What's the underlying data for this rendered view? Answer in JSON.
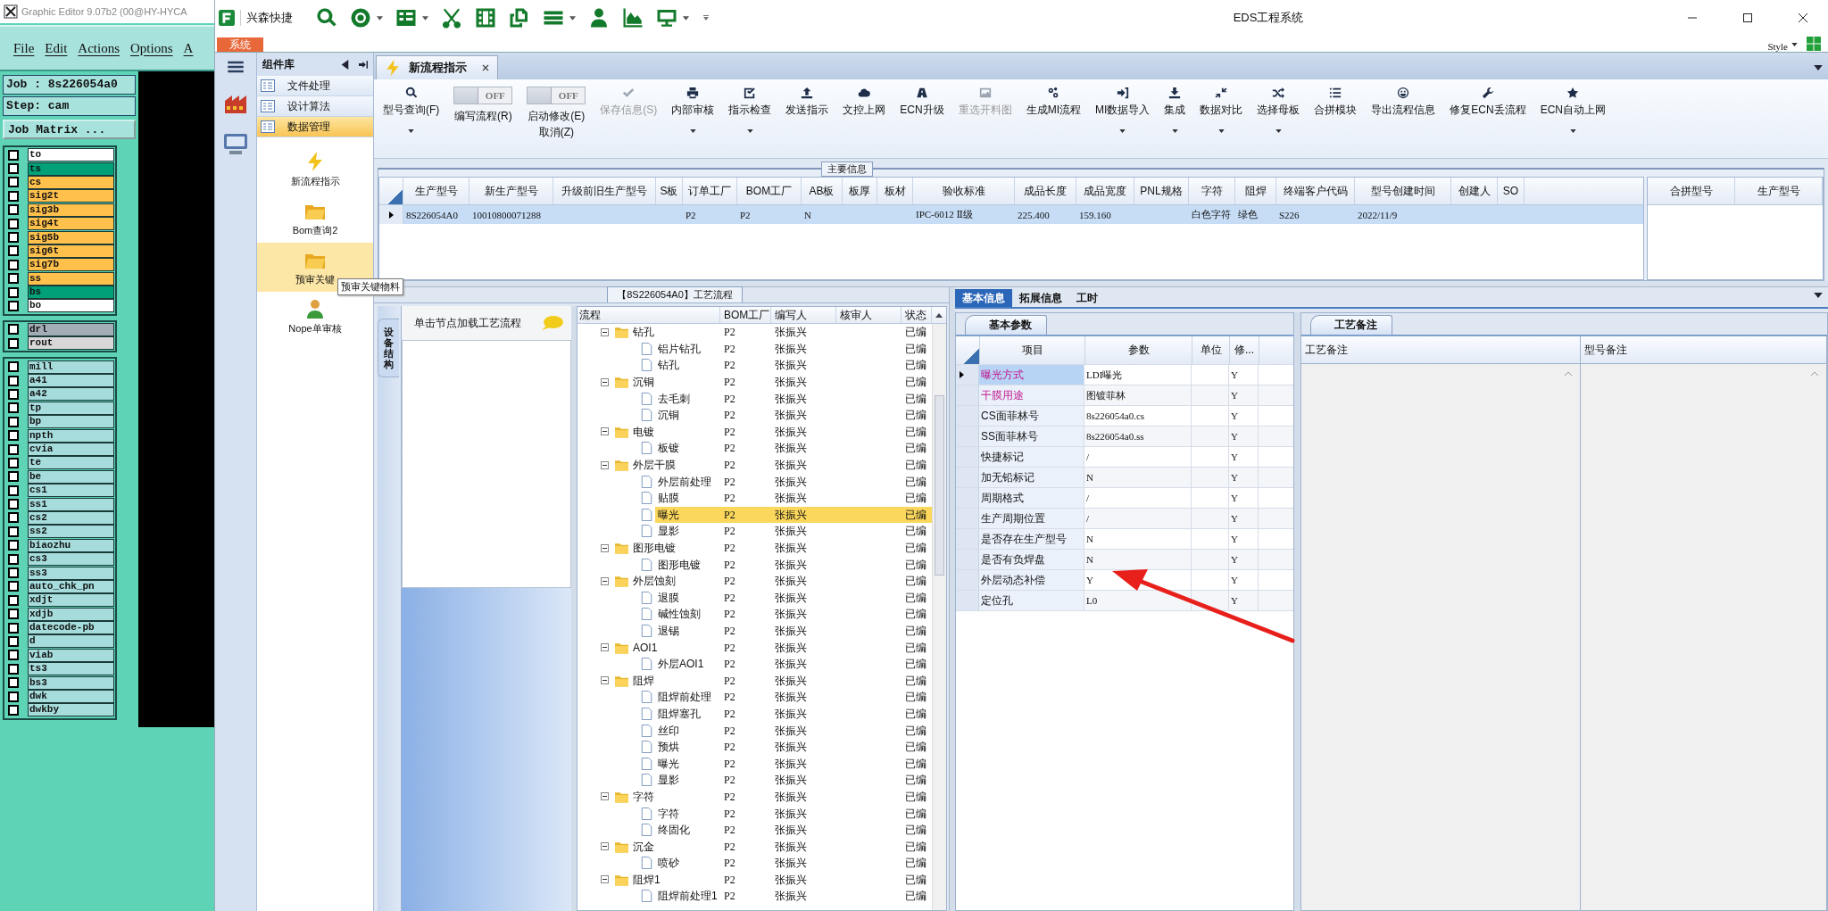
{
  "graphic_editor": {
    "title": "Graphic Editor 9.07b2 (00@HY-HYCA",
    "menu": [
      "File",
      "Edit",
      "Actions",
      "Options",
      "A"
    ],
    "job": "Job : 8s226054a0",
    "step": "Step: cam",
    "matrix_button": "Job Matrix ...",
    "layer_groups": [
      {
        "layers": [
          {
            "name": "to",
            "checked": false,
            "color": "#ffffff"
          },
          {
            "name": "ts",
            "checked": false,
            "color": "#00a078"
          },
          {
            "name": "cs",
            "checked": false,
            "color": "#ffc04c"
          },
          {
            "name": "sig2t",
            "checked": false,
            "color": "#ffc04c"
          },
          {
            "name": "sig3b",
            "checked": false,
            "color": "#ffc04c"
          },
          {
            "name": "sig4t",
            "checked": false,
            "color": "#ffc04c"
          },
          {
            "name": "sig5b",
            "checked": false,
            "color": "#ffc04c"
          },
          {
            "name": "sig6t",
            "checked": false,
            "color": "#ffc04c"
          },
          {
            "name": "sig7b",
            "checked": false,
            "color": "#ffc04c"
          },
          {
            "name": "ss",
            "checked": false,
            "color": "#ffc04c"
          },
          {
            "name": "bs",
            "checked": false,
            "color": "#00a078"
          },
          {
            "name": "bo",
            "checked": false,
            "color": "#ffffff"
          }
        ]
      },
      {
        "layers": [
          {
            "name": "drl",
            "checked": false,
            "color": "#a3adb5"
          },
          {
            "name": "rout",
            "checked": false,
            "color": "#d8d8d8"
          }
        ]
      },
      {
        "layers": [
          {
            "name": "mill",
            "checked": false,
            "color": "#a6dcdc"
          },
          {
            "name": "a41",
            "checked": false,
            "color": "#a6dcdc"
          },
          {
            "name": "a42",
            "checked": false,
            "color": "#a6dcdc"
          },
          {
            "name": "tp",
            "checked": false,
            "color": "#a6dcdc"
          },
          {
            "name": "bp",
            "checked": false,
            "color": "#a6dcdc"
          },
          {
            "name": "npth",
            "checked": false,
            "color": "#a6dcdc"
          },
          {
            "name": "cvia",
            "checked": false,
            "color": "#a6dcdc"
          },
          {
            "name": "te",
            "checked": false,
            "color": "#a6dcdc"
          },
          {
            "name": "be",
            "checked": false,
            "color": "#a6dcdc"
          },
          {
            "name": "cs1",
            "checked": false,
            "color": "#a6dcdc"
          },
          {
            "name": "ss1",
            "checked": false,
            "color": "#a6dcdc"
          },
          {
            "name": "cs2",
            "checked": false,
            "color": "#a6dcdc"
          },
          {
            "name": "ss2",
            "checked": false,
            "color": "#a6dcdc"
          },
          {
            "name": "biaozhu",
            "checked": false,
            "color": "#a6dcdc"
          },
          {
            "name": "cs3",
            "checked": false,
            "color": "#a6dcdc"
          },
          {
            "name": "ss3",
            "checked": false,
            "color": "#a6dcdc"
          },
          {
            "name": "auto_chk_pn",
            "checked": false,
            "color": "#a6dcdc"
          },
          {
            "name": "xdjt",
            "checked": false,
            "color": "#a6dcdc"
          },
          {
            "name": "xdjb",
            "checked": false,
            "color": "#a6dcdc"
          },
          {
            "name": "datecode-pb",
            "checked": false,
            "color": "#a6dcdc"
          },
          {
            "name": "d",
            "checked": false,
            "color": "#a6dcdc"
          },
          {
            "name": "viab",
            "checked": false,
            "color": "#a6dcdc"
          },
          {
            "name": "ts3",
            "checked": false,
            "color": "#a6dcdc"
          },
          {
            "name": "bs3",
            "checked": false,
            "color": "#a6dcdc"
          },
          {
            "name": "dwk",
            "checked": false,
            "color": "#a6dcdc"
          },
          {
            "name": "dwkby",
            "checked": false,
            "color": "#a6dcdc"
          }
        ]
      }
    ]
  },
  "eds_window": {
    "title": "EDS工程系统",
    "quick_access_label": "兴森快捷",
    "system_tab": "系统",
    "style_menu": "Style"
  },
  "component_library": {
    "title": "组件库",
    "categories": [
      {
        "label": "文件处理",
        "selected": false
      },
      {
        "label": "设计算法",
        "selected": false
      },
      {
        "label": "数据管理",
        "selected": true
      }
    ],
    "modules": [
      {
        "label": "新流程指示",
        "selected": false
      },
      {
        "label": "Bom查询2",
        "selected": false
      },
      {
        "label": "预审关键",
        "selected": true,
        "tooltip": "预审关键物料"
      },
      {
        "label": "Nope单审核",
        "selected": false
      }
    ]
  },
  "document_tab": {
    "label": "新流程指示",
    "selected": true
  },
  "toolbar": [
    {
      "kind": "button",
      "label": "型号查询(F)",
      "disabled": false,
      "dropdown": true
    },
    {
      "kind": "toggle",
      "label": "编写流程(R)",
      "switch_text": "OFF",
      "on": false
    },
    {
      "kind": "toggle",
      "label": "启动修改(E)\n取消(Z)",
      "switch_text": "OFF",
      "on": false
    },
    {
      "kind": "button",
      "label": "保存信息(S)",
      "disabled": true,
      "dropdown": false
    },
    {
      "kind": "button",
      "label": "内部审核",
      "disabled": false,
      "dropdown": true
    },
    {
      "kind": "button",
      "label": "指示检查",
      "disabled": false,
      "dropdown": true
    },
    {
      "kind": "button",
      "label": "发送指示",
      "disabled": false,
      "dropdown": false
    },
    {
      "kind": "button",
      "label": "文控上网",
      "disabled": false,
      "dropdown": false
    },
    {
      "kind": "button",
      "label": "ECN升级",
      "disabled": false,
      "dropdown": false
    },
    {
      "kind": "button",
      "label": "重选开料图",
      "disabled": true,
      "dropdown": false
    },
    {
      "kind": "button",
      "label": "生成MI流程",
      "disabled": false,
      "dropdown": false
    },
    {
      "kind": "button",
      "label": "MI数据导入",
      "disabled": false,
      "dropdown": true
    },
    {
      "kind": "button",
      "label": "集成",
      "disabled": false,
      "dropdown": true
    },
    {
      "kind": "button",
      "label": "数据对比",
      "disabled": false,
      "dropdown": true
    },
    {
      "kind": "button",
      "label": "选择母板",
      "disabled": false,
      "dropdown": true
    },
    {
      "kind": "button",
      "label": "合拼模块",
      "disabled": false,
      "dropdown": false
    },
    {
      "kind": "button",
      "label": "导出流程信息",
      "disabled": false,
      "dropdown": false
    },
    {
      "kind": "button",
      "label": "修复ECN丢流程",
      "disabled": false,
      "dropdown": false
    },
    {
      "kind": "button",
      "label": "ECN自动上网",
      "disabled": false,
      "dropdown": true
    }
  ],
  "main_info": {
    "title": "主要信息",
    "columns": [
      "生产型号",
      "新生产型号",
      "升级前旧生产型号",
      "S板",
      "订单工厂",
      "BOM工厂",
      "AB板",
      "板厚",
      "板材",
      "验收标准",
      "成品长度",
      "成品宽度",
      "PNL规格",
      "字符",
      "阻焊",
      "终端客户代码",
      "型号创建时间",
      "创建人",
      "SO"
    ],
    "rows": [
      {
        "selected": true,
        "cells": [
          "8S226054A0",
          "10010800071288",
          null,
          null,
          "P2",
          "P2",
          "N",
          null,
          null,
          "IPC-6012 Ⅱ级",
          "225.400",
          "159.160",
          null,
          "白色字符",
          "绿色",
          "S226",
          "2022/11/9",
          null,
          null
        ]
      }
    ],
    "merge_table": {
      "columns": [
        "合拼型号",
        "生产型号"
      ]
    }
  },
  "process_flow": {
    "title": "【8S226054A0】工艺流程",
    "side_tab": "设备结构",
    "hint": "单击节点加载工艺流程",
    "columns": [
      "流程",
      "BOM工厂",
      "编写人",
      "核审人",
      "状态"
    ],
    "tree": [
      {
        "name": "钻孔",
        "bom": "P2",
        "writer": "张振兴",
        "status": "已编",
        "expanded": true,
        "selected": false,
        "children": [
          {
            "name": "铝片钻孔",
            "bom": "P2",
            "writer": "张振兴",
            "status": "已编",
            "selected": false
          },
          {
            "name": "钻孔",
            "bom": "P2",
            "writer": "张振兴",
            "status": "已编",
            "selected": false
          }
        ]
      },
      {
        "name": "沉铜",
        "bom": "P2",
        "writer": "张振兴",
        "status": "已编",
        "expanded": true,
        "selected": false,
        "children": [
          {
            "name": "去毛刺",
            "bom": "P2",
            "writer": "张振兴",
            "status": "已编",
            "selected": false
          },
          {
            "name": "沉铜",
            "bom": "P2",
            "writer": "张振兴",
            "status": "已编",
            "selected": false
          }
        ]
      },
      {
        "name": "电镀",
        "bom": "P2",
        "writer": "张振兴",
        "status": "已编",
        "expanded": true,
        "selected": false,
        "children": [
          {
            "name": "板镀",
            "bom": "P2",
            "writer": "张振兴",
            "status": "已编",
            "selected": false
          }
        ]
      },
      {
        "name": "外层干膜",
        "bom": "P2",
        "writer": "张振兴",
        "status": "已编",
        "expanded": true,
        "selected": false,
        "children": [
          {
            "name": "外层前处理",
            "bom": "P2",
            "writer": "张振兴",
            "status": "已编",
            "selected": false
          },
          {
            "name": "贴膜",
            "bom": "P2",
            "writer": "张振兴",
            "status": "已编",
            "selected": false
          },
          {
            "name": "曝光",
            "bom": "P2",
            "writer": "张振兴",
            "status": "已编",
            "selected": true
          },
          {
            "name": "显影",
            "bom": "P2",
            "writer": "张振兴",
            "status": "已编",
            "selected": false
          }
        ]
      },
      {
        "name": "图形电镀",
        "bom": "P2",
        "writer": "张振兴",
        "status": "已编",
        "expanded": true,
        "selected": false,
        "children": [
          {
            "name": "图形电镀",
            "bom": "P2",
            "writer": "张振兴",
            "status": "已编",
            "selected": false
          }
        ]
      },
      {
        "name": "外层蚀刻",
        "bom": "P2",
        "writer": "张振兴",
        "status": "已编",
        "expanded": true,
        "selected": false,
        "children": [
          {
            "name": "退膜",
            "bom": "P2",
            "writer": "张振兴",
            "status": "已编",
            "selected": false
          },
          {
            "name": "碱性蚀刻",
            "bom": "P2",
            "writer": "张振兴",
            "status": "已编",
            "selected": false
          },
          {
            "name": "退锡",
            "bom": "P2",
            "writer": "张振兴",
            "status": "已编",
            "selected": false
          }
        ]
      },
      {
        "name": "AOI1",
        "bom": "P2",
        "writer": "张振兴",
        "status": "已编",
        "expanded": true,
        "selected": false,
        "children": [
          {
            "name": "外层AOI1",
            "bom": "P2",
            "writer": "张振兴",
            "status": "已编",
            "selected": false
          }
        ]
      },
      {
        "name": "阻焊",
        "bom": "P2",
        "writer": "张振兴",
        "status": "已编",
        "expanded": true,
        "selected": false,
        "children": [
          {
            "name": "阻焊前处理",
            "bom": "P2",
            "writer": "张振兴",
            "status": "已编",
            "selected": false
          },
          {
            "name": "阻焊塞孔",
            "bom": "P2",
            "writer": "张振兴",
            "status": "已编",
            "selected": false
          },
          {
            "name": "丝印",
            "bom": "P2",
            "writer": "张振兴",
            "status": "已编",
            "selected": false
          },
          {
            "name": "预烘",
            "bom": "P2",
            "writer": "张振兴",
            "status": "已编",
            "selected": false
          },
          {
            "name": "曝光",
            "bom": "P2",
            "writer": "张振兴",
            "status": "已编",
            "selected": false
          },
          {
            "name": "显影",
            "bom": "P2",
            "writer": "张振兴",
            "status": "已编",
            "selected": false
          }
        ]
      },
      {
        "name": "字符",
        "bom": "P2",
        "writer": "张振兴",
        "status": "已编",
        "expanded": true,
        "selected": false,
        "children": [
          {
            "name": "字符",
            "bom": "P2",
            "writer": "张振兴",
            "status": "已编",
            "selected": false
          },
          {
            "name": "终固化",
            "bom": "P2",
            "writer": "张振兴",
            "status": "已编",
            "selected": false
          }
        ]
      },
      {
        "name": "沉金",
        "bom": "P2",
        "writer": "张振兴",
        "status": "已编",
        "expanded": true,
        "selected": false,
        "children": [
          {
            "name": "喷砂",
            "bom": "P2",
            "writer": "张振兴",
            "status": "已编",
            "selected": false
          }
        ]
      },
      {
        "name": "阻焊1",
        "bom": "P2",
        "writer": "张振兴",
        "status": "已编",
        "expanded": true,
        "selected": false,
        "children": [
          {
            "name": "阻焊前处理1",
            "bom": "P2",
            "writer": "张振兴",
            "status": "已编",
            "selected": false
          }
        ]
      }
    ]
  },
  "detail_tabs": [
    {
      "label": "基本信息",
      "selected": true
    },
    {
      "label": "拓展信息",
      "selected": false
    },
    {
      "label": "工时",
      "selected": false
    }
  ],
  "basic_params": {
    "tab": "基本参数",
    "columns": [
      "项目",
      "参数",
      "单位",
      "修..."
    ],
    "rows": [
      {
        "item": "曝光方式",
        "value": "LDI曝光",
        "modified": "Y",
        "flagged": true,
        "selected": true
      },
      {
        "item": "干膜用途",
        "value": "图镀菲林",
        "modified": "Y",
        "flagged": true,
        "selected": false
      },
      {
        "item": "CS面菲林号",
        "value": "8s226054a0.cs",
        "modified": "Y",
        "flagged": false,
        "selected": false
      },
      {
        "item": "SS面菲林号",
        "value": "8s226054a0.ss",
        "modified": "Y",
        "flagged": false,
        "selected": false
      },
      {
        "item": "快捷标记",
        "value": "/",
        "modified": "Y",
        "flagged": false,
        "selected": false
      },
      {
        "item": "加无铅标记",
        "value": "N",
        "modified": "Y",
        "flagged": false,
        "selected": false
      },
      {
        "item": "周期格式",
        "value": "/",
        "modified": "Y",
        "flagged": false,
        "selected": false
      },
      {
        "item": "生产周期位置",
        "value": "/",
        "modified": "Y",
        "flagged": false,
        "selected": false
      },
      {
        "item": "是否存在生产型号",
        "value": "N",
        "modified": "Y",
        "flagged": false,
        "selected": false
      },
      {
        "item": "是否有负焊盘",
        "value": "N",
        "modified": "Y",
        "flagged": false,
        "selected": false
      },
      {
        "item": "外层动态补偿",
        "value": "Y",
        "modified": "Y",
        "flagged": false,
        "selected": false
      },
      {
        "item": "定位孔",
        "value": "L0",
        "modified": "Y",
        "flagged": false,
        "selected": false
      }
    ]
  },
  "process_notes": {
    "tab": "工艺备注",
    "columns": [
      "工艺备注",
      "型号备注"
    ]
  }
}
